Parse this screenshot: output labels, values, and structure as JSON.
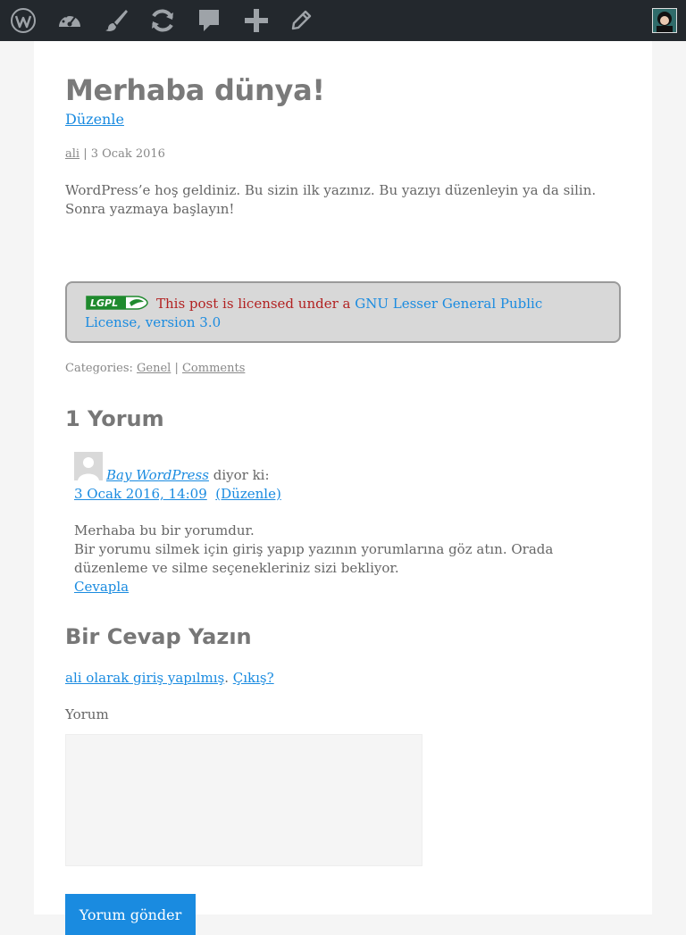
{
  "adminbar": {
    "icons": [
      "wordpress-icon",
      "dashboard-icon",
      "customize-icon",
      "updates-icon",
      "comments-icon",
      "new-content-icon",
      "edit-icon"
    ],
    "colors": {
      "bg": "#23282d",
      "icon": "#9ea3a8"
    }
  },
  "post": {
    "title": "Merhaba dünya!",
    "edit_label": "Düzenle",
    "author": "ali",
    "meta_sep": " | ",
    "date": "3 Ocak 2016",
    "body": "WordPress’e hoş geldiniz. Bu sizin ilk yazınız. Bu yazıyı düzenleyin ya da silin. Sonra yazmaya başlayın!"
  },
  "license": {
    "logo_text": "LGPL",
    "text": "This post is licensed under a ",
    "link": "GNU Lesser General Public License, version 3.0"
  },
  "categories": {
    "label": "Categories: ",
    "category": "Genel",
    "sep": " | ",
    "comments_link": "Comments"
  },
  "comments": {
    "title": "1 Yorum",
    "items": [
      {
        "author": "Bay WordPress",
        "says": " diyor ki:",
        "date": "3 Ocak 2016, 14:09",
        "edit": "(Düzenle)",
        "line1": "Merhaba bu bir yorumdur.",
        "line2": "Bir yorumu silmek için giriş yapıp yazının yorumlarına göz atın. Orada düzenleme ve silme seçenekleriniz sizi bekliyor.",
        "reply": "Cevapla"
      }
    ]
  },
  "reply_form": {
    "title": "Bir Cevap Yazın",
    "logged_in": "ali olarak giriş yapılmış",
    "dot": ". ",
    "logout": "Çıkış?",
    "field_label": "Yorum",
    "submit": "Yorum gönder"
  },
  "colors": {
    "link": "#1a8be0",
    "license_text": "#b22222",
    "license_bg": "#d8d8d8"
  }
}
